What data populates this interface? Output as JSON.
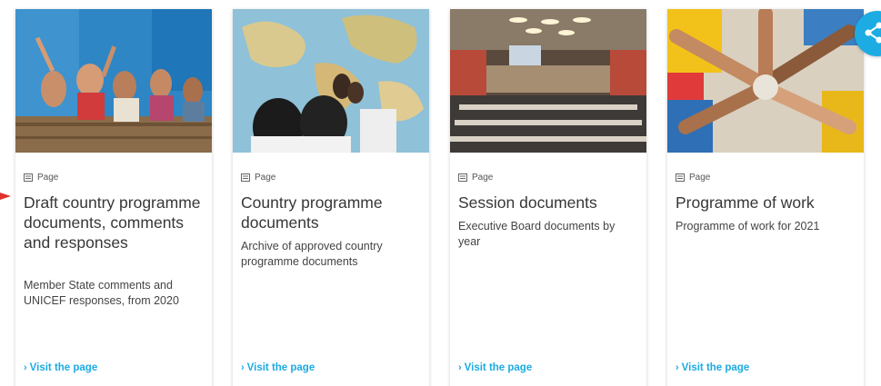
{
  "colors": {
    "accent": "#1CABE2",
    "title": "#373737",
    "text": "#444444"
  },
  "cards": [
    {
      "type_label": "Page",
      "type_icon": "page-icon",
      "image": "children-classroom-photo",
      "title": "Draft country programme documents, comments and responses",
      "description": "Member State comments and UNICEF responses, from 2020",
      "link_label": "Visit the page"
    },
    {
      "type_label": "Page",
      "type_icon": "page-icon",
      "image": "world-map-photo",
      "title": "Country programme documents",
      "description": "Archive of approved country programme documents",
      "link_label": "Visit the page"
    },
    {
      "type_label": "Page",
      "type_icon": "page-icon",
      "image": "assembly-hall-photo",
      "title": "Session documents",
      "description": "Executive Board documents by year",
      "link_label": "Visit the page"
    },
    {
      "type_label": "Page",
      "type_icon": "page-icon",
      "image": "joined-hands-photo",
      "title": "Programme of work",
      "description": "Programme of work for 2021",
      "link_label": "Visit the page"
    }
  ],
  "share": {
    "icon": "share-icon"
  }
}
